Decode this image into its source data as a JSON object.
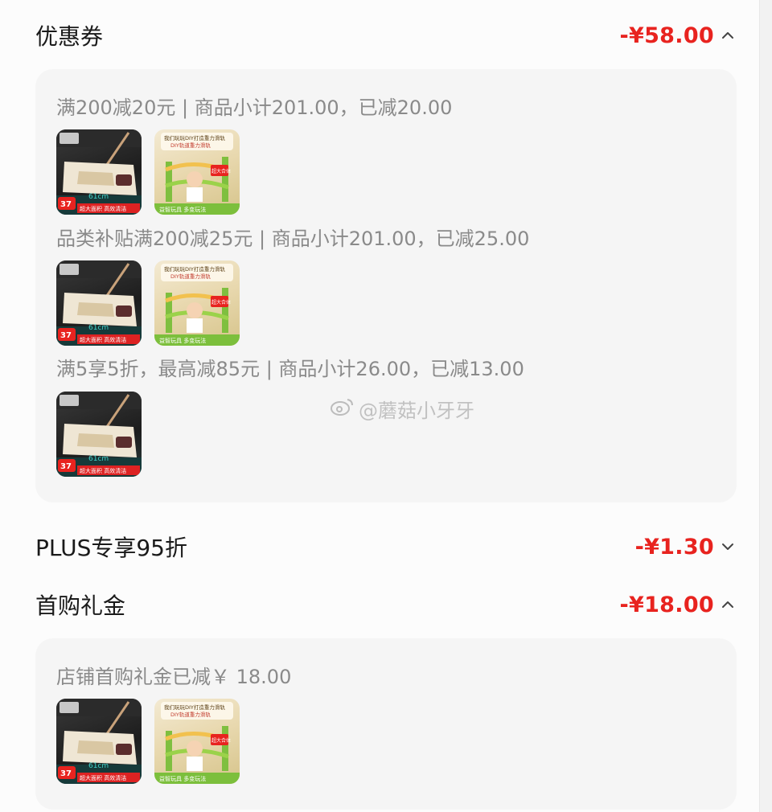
{
  "coupon": {
    "title": "优惠券",
    "amount": "-¥58.00",
    "expanded": true,
    "groups": [
      {
        "text": "满200减20元 | 商品小计201.00，已减20.00",
        "products": [
          "mop",
          "toy"
        ]
      },
      {
        "text": "品类补贴满200减25元 | 商品小计201.00，已减25.00",
        "products": [
          "mop",
          "toy"
        ]
      },
      {
        "text": "满5享5折，最高减85元 | 商品小计26.00，已减13.00",
        "products": [
          "mop"
        ]
      }
    ]
  },
  "plus": {
    "title": "PLUS专享95折",
    "amount": "-¥1.30",
    "expanded": false
  },
  "first_purchase": {
    "title": "首购礼金",
    "amount": "-¥18.00",
    "expanded": true,
    "groups": [
      {
        "text": "店铺首购礼金已减￥ 18.00",
        "products": [
          "mop",
          "toy"
        ]
      }
    ]
  },
  "mop_thumb": {
    "badge": "37",
    "caption": "超大面积 高效清洁",
    "size_label": "61cm"
  },
  "toy_thumb": {
    "headline": "我们玩玩DIY打造重力滑轨",
    "sub": "DIY轨道重力滑轨",
    "sticker": "超大合体",
    "caption": "益智玩具 多变玩法"
  },
  "watermark": {
    "text": "@蘑菇小牙牙",
    "icon": "weibo-icon"
  },
  "colors": {
    "accent": "#e8231f",
    "panel": "#f5f5f5",
    "muted_text": "#8a8a8a"
  }
}
